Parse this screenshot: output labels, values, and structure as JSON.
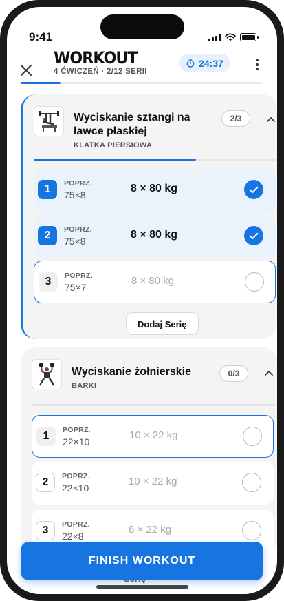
{
  "status": {
    "time": "9:41"
  },
  "header": {
    "title": "WORKOUT",
    "subtitle": "4 ĆWICZEŃ · 2/12 SERII",
    "timer": "24:37",
    "progress": 0.166
  },
  "exercises": [
    {
      "name": "Wyciskanie sztangi na ławce płaskiej",
      "muscle": "KLATKA PIERSIOWA",
      "count": "2/3",
      "progress": 0.667,
      "sets": [
        {
          "num": "1",
          "prev_label": "POPRZ.",
          "prev": "75×8",
          "target": "8 × 80 kg",
          "state": "done"
        },
        {
          "num": "2",
          "prev_label": "POPRZ.",
          "prev": "75×8",
          "target": "8 × 80 kg",
          "state": "done"
        },
        {
          "num": "3",
          "prev_label": "POPRZ.",
          "prev": "75×7",
          "target": "8 × 80 kg",
          "state": "current"
        }
      ],
      "add_label": "Dodaj Serię"
    },
    {
      "name": "Wyciskanie żołnierskie",
      "muscle": "BARKI",
      "count": "0/3",
      "progress": 0,
      "sets": [
        {
          "num": "1",
          "prev_label": "POPRZ.",
          "prev": "22×10",
          "target": "10 × 22 kg",
          "state": "current"
        },
        {
          "num": "2",
          "prev_label": "POPRZ.",
          "prev": "22×10",
          "target": "10 × 22 kg",
          "state": "pending"
        },
        {
          "num": "3",
          "prev_label": "POPRZ.",
          "prev": "22×8",
          "target": "8 × 22 kg",
          "state": "pending"
        }
      ],
      "add_label_partial": "Serię"
    }
  ],
  "finish_label": "FINISH WORKOUT",
  "colors": {
    "accent": "#1675e0",
    "done_bg": "#eaf2fc",
    "card_bg": "#f4f4f4"
  }
}
